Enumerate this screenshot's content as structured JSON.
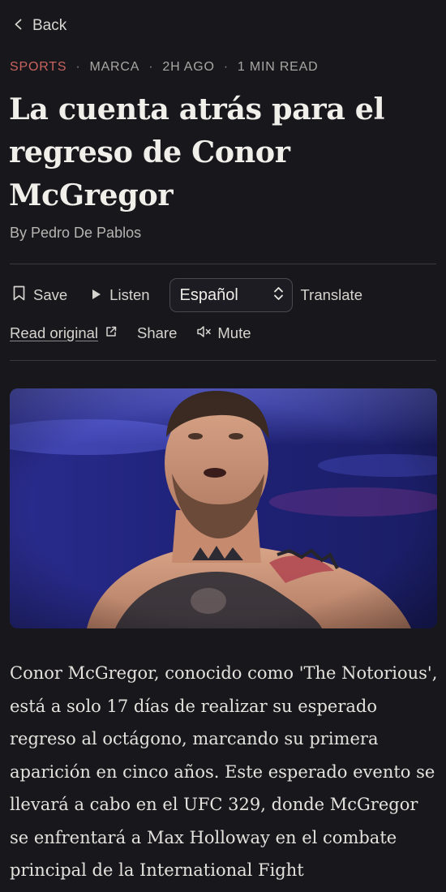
{
  "nav": {
    "back_label": "Back"
  },
  "meta": {
    "category": "SPORTS",
    "source": "MARCA",
    "time": "2H AGO",
    "read_time": "1 MIN READ",
    "separator": "·"
  },
  "article": {
    "headline": "La cuenta atrás para el regreso de Conor McGregor",
    "byline": "By Pedro De Pablos",
    "body": "Conor McGregor, conocido como 'The Notorious', está a solo 17 días de realizar su esperado regreso al octágono, marcando su primera aparición en cinco años. Este esperado evento se llevará a cabo en el UFC 329, donde McGregor se enfrentará a Max Holloway en el combate principal de la International Fight"
  },
  "toolbar": {
    "save_label": "Save",
    "listen_label": "Listen",
    "language_selected": "Español",
    "translate_label": "Translate",
    "read_original_label": "Read original",
    "share_label": "Share",
    "mute_label": "Mute"
  },
  "icons": {
    "back": "chevron-left-icon",
    "save": "bookmark-icon",
    "listen": "play-icon",
    "language": "chevron-up-down-icon",
    "read_original": "external-link-icon",
    "mute": "speaker-mute-icon"
  },
  "colors": {
    "background": "#18171c",
    "category_accent": "#c9645f",
    "text": "#e9e7e2",
    "muted": "#a9a7a3",
    "divider": "#3a3940"
  }
}
